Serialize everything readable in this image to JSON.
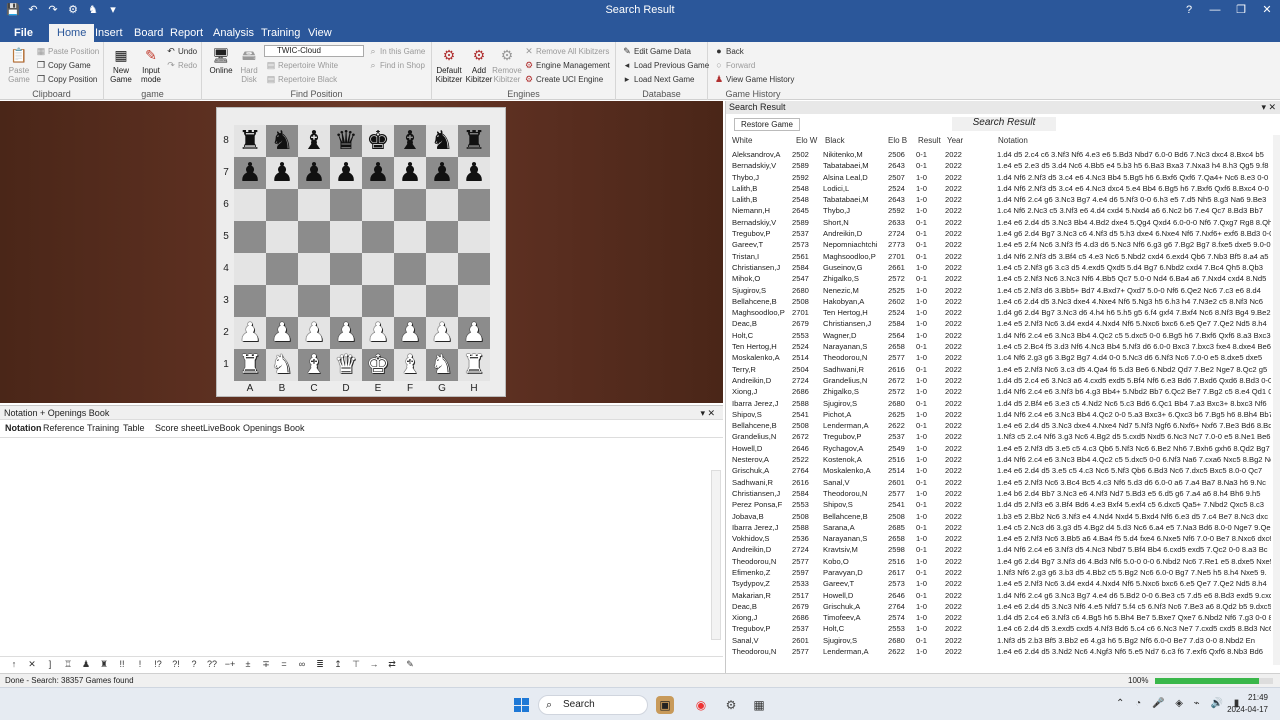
{
  "titlebar": {
    "title": "Search Result",
    "quick_access": [
      "💾",
      "↶",
      "↷",
      "⚙",
      "♞",
      "▾"
    ],
    "window_buttons": [
      "?",
      "—",
      "❐",
      "✕"
    ]
  },
  "ribbon_tabs": {
    "file": "File",
    "home": "Home",
    "insert": "Insert",
    "board": "Board",
    "report": "Report",
    "analysis": "Analysis",
    "training": "Training",
    "view": "View"
  },
  "ribbon": {
    "clipboard": {
      "label": "Clipboard",
      "paste_game": "Paste\nGame",
      "paste_position": "Paste Position",
      "copy_game": "Copy Game",
      "copy_position": "Copy Position"
    },
    "game": {
      "label": "game",
      "new_game": "New\nGame",
      "input_mode": "Input\nmode",
      "undo": "Undo",
      "redo": "Redo"
    },
    "find_position": {
      "label": "Find Position",
      "online": "Online",
      "hard_disk": "Hard\nDisk",
      "dropdown_value": "TWIC-Cloud",
      "in_this_game": "In this Game",
      "find_in_shop": "Find in Shop",
      "repertoire_white": "Repertoire White",
      "repertoire_black": "Repertoire Black"
    },
    "engines": {
      "label": "Engines",
      "default_kibitzer": "Default\nKibitzer",
      "add_kibitzer": "Add\nKibitzer",
      "remove_kibitzer": "Remove\nKibitzer",
      "remove_all_kibitzers": "Remove All Kibitzers",
      "engine_management": "Engine Management",
      "create_uci_engine": "Create UCI Engine"
    },
    "database": {
      "label": "Database",
      "edit_game_data": "Edit Game Data",
      "load_previous_game": "Load Previous Game",
      "load_next_game": "Load Next Game"
    },
    "game_history": {
      "label": "Game History",
      "back": "Back",
      "forward": "Forward",
      "view_game_history": "View Game History"
    }
  },
  "board": {
    "ranks": [
      "8",
      "7",
      "6",
      "5",
      "4",
      "3",
      "2",
      "1"
    ],
    "files": [
      "A",
      "B",
      "C",
      "D",
      "E",
      "F",
      "G",
      "H"
    ],
    "position": [
      [
        "br",
        "bn",
        "bb",
        "bq",
        "bk",
        "bb",
        "bn",
        "br"
      ],
      [
        "bp",
        "bp",
        "bp",
        "bp",
        "bp",
        "bp",
        "bp",
        "bp"
      ],
      [
        "",
        "",
        "",
        "",
        "",
        "",
        "",
        ""
      ],
      [
        "",
        "",
        "",
        "",
        "",
        "",
        "",
        ""
      ],
      [
        "",
        "",
        "",
        "",
        "",
        "",
        "",
        ""
      ],
      [
        "",
        "",
        "",
        "",
        "",
        "",
        "",
        ""
      ],
      [
        "wp",
        "wp",
        "wp",
        "wp",
        "wp",
        "wp",
        "wp",
        "wp"
      ],
      [
        "wr",
        "wn",
        "wb",
        "wq",
        "wk",
        "wb",
        "wn",
        "wr"
      ]
    ]
  },
  "notation_pane": {
    "header": "Notation + Openings Book",
    "tabs": [
      "Notation",
      "Reference",
      "Training",
      "Table",
      "Score sheet",
      "LiveBook",
      "Openings Book"
    ],
    "toolbar_icons": [
      "↑",
      "✕",
      "]",
      "♖",
      "♟",
      "♜",
      "!!",
      "!",
      "!?",
      "?!",
      "?",
      "??",
      "−+",
      "±",
      "∓",
      "=",
      "∞",
      "≣",
      "↥",
      "⊤",
      "→",
      "⇄",
      "✎"
    ]
  },
  "search_result": {
    "pane_title": "Search Result",
    "restore_button": "Restore Game",
    "title": "Search Result",
    "columns": [
      "White",
      "Elo W",
      "Black",
      "Elo B",
      "Result",
      "Year",
      "Notation"
    ],
    "rows": [
      [
        "Aleksandrov,A",
        "2502",
        "Nikitenko,M",
        "2506",
        "0-1",
        "2022",
        "1.d4 d5 2.c4 c6 3.Nf3 Nf6 4.e3 e6 5.Bd3 Nbd7 6.0-0 Bd6 7.Nc3 dxc4 8.Bxc4 b5"
      ],
      [
        "Bernadskiy,V",
        "2589",
        "Tabatabaei,M",
        "2643",
        "0-1",
        "2022",
        "1.e4 e5 2.e3 d5 3.d4 Nc6 4.Bb5 e4 5.b3 h5 6.Ba3 Bxa3 7.Nxa3 h4 8.h3 Qg5 9.f8"
      ],
      [
        "Thybo,J",
        "2592",
        "Alsina Leal,D",
        "2507",
        "1-0",
        "2022",
        "1.d4 Nf6 2.Nf3 d5 3.c4 e6 4.Nc3 Bb4 5.Bg5 h6 6.Bxf6 Qxf6 7.Qa4+ Nc6 8.e3 0-0"
      ],
      [
        "Lalith,B",
        "2548",
        "Lodici,L",
        "2524",
        "1-0",
        "2022",
        "1.d4 Nf6 2.Nf3 d5 3.c4 e6 4.Nc3 dxc4 5.e4 Bb4 6.Bg5 h6 7.Bxf6 Qxf6 8.Bxc4 0-0"
      ],
      [
        "Lalith,B",
        "2548",
        "Tabatabaei,M",
        "2643",
        "1-0",
        "2022",
        "1.d4 Nf6 2.c4 g6 3.Nc3 Bg7 4.e4 d6 5.Nf3 0-0 6.h3 e5 7.d5 Nh5 8.g3 Na6 9.Be3"
      ],
      [
        "Niemann,H",
        "2645",
        "Thybo,J",
        "2592",
        "1-0",
        "2022",
        "1.c4 Nf6 2.Nc3 c5 3.Nf3 e6 4.d4 cxd4 5.Nxd4 a6 6.Nc2 b6 7.e4 Qc7 8.Bd3 Bb7"
      ],
      [
        "Bernadskiy,V",
        "2589",
        "Short,N",
        "2633",
        "0-1",
        "2022",
        "1.e4 e6 2.d4 d5 3.Nc3 Bb4 4.Bd2 dxe4 5.Qg4 Qxd4 6.0-0-0 Nf6 7.Qxg7 Rg8 8.Qh6"
      ],
      [
        "Tregubov,P",
        "2537",
        "Andreikin,D",
        "2724",
        "0-1",
        "2022",
        "1.e4 g6 2.d4 Bg7 3.Nc3 c6 4.Nf3 d5 5.h3 dxe4 6.Nxe4 Nf6 7.Nxf6+ exf6 8.Bd3 0-0"
      ],
      [
        "Gareev,T",
        "2573",
        "Nepomniachtchi",
        "2773",
        "0-1",
        "2022",
        "1.e4 e5 2.f4 Nc6 3.Nf3 f5 4.d3 d6 5.Nc3 Nf6 6.g3 g6 7.Bg2 Bg7 8.fxe5 dxe5 9.0-0"
      ],
      [
        "Tristan,I",
        "2561",
        "Maghsoodloo,P",
        "2701",
        "0-1",
        "2022",
        "1.d4 Nf6 2.Nf3 d5 3.Bf4 c5 4.e3 Nc6 5.Nbd2 cxd4 6.exd4 Qb6 7.Nb3 Bf5 8.a4 a5"
      ],
      [
        "Christiansen,J",
        "2584",
        "Guseinov,G",
        "2661",
        "1-0",
        "2022",
        "1.e4 c5 2.Nf3 g6 3.c3 d5 4.exd5 Qxd5 5.d4 Bg7 6.Nbd2 cxd4 7.Bc4 Qh5 8.Qb3"
      ],
      [
        "Mihok,O",
        "2547",
        "Zhigalko,S",
        "2572",
        "0-1",
        "2022",
        "1.e4 c5 2.Nf3 Nc6 3.Nc3 Nf6 4.Bb5 Qc7 5.0-0 Nd4 6.Ba4 a6 7.Nxd4 cxd4 8.Nd5"
      ],
      [
        "Sjugirov,S",
        "2680",
        "Nenezic,M",
        "2525",
        "1-0",
        "2022",
        "1.e4 c5 2.Nf3 d6 3.Bb5+ Bd7 4.Bxd7+ Qxd7 5.0-0 Nf6 6.Qe2 Nc6 7.c3 e6 8.d4"
      ],
      [
        "Bellahcene,B",
        "2508",
        "Hakobyan,A",
        "2602",
        "1-0",
        "2022",
        "1.e4 c6 2.d4 d5 3.Nc3 dxe4 4.Nxe4 Nf6 5.Ng3 h5 6.h3 h4 7.N3e2 c5 8.Nf3 Nc6"
      ],
      [
        "Maghsoodloo,P",
        "2701",
        "Ten Hertog,H",
        "2524",
        "1-0",
        "2022",
        "1.d4 g6 2.d4 Bg7 3.Nc3 d6 4.h4 h6 5.h5 g5 6.f4 gxf4 7.Bxf4 Nc6 8.Nf3 Bg4 9.Be2"
      ],
      [
        "Deac,B",
        "2679",
        "Christiansen,J",
        "2584",
        "1-0",
        "2022",
        "1.e4 e5 2.Nf3 Nc6 3.d4 exd4 4.Nxd4 Nf6 5.Nxc6 bxc6 6.e5 Qe7 7.Qe2 Nd5 8.h4"
      ],
      [
        "Holt,C",
        "2553",
        "Wagner,D",
        "2564",
        "1-0",
        "2022",
        "1.d4 Nf6 2.c4 e6 3.Nc3 Bb4 4.Qc2 c5 5.dxc5 0-0 6.Bg5 h6 7.Bxf6 Qxf6 8.a3 Bxc3+"
      ],
      [
        "Ten Hertog,H",
        "2524",
        "Narayanan,S",
        "2658",
        "0-1",
        "2022",
        "1.e4 c5 2.Bc4 f5 3.d3 Nf6 4.Nc3 Bb4 5.Nf3 d6 6.0-0 Bxc3 7.bxc3 fxe4 8.dxe4 Be6"
      ],
      [
        "Moskalenko,A",
        "2514",
        "Theodorou,N",
        "2577",
        "1-0",
        "2022",
        "1.c4 Nf6 2.g3 g6 3.Bg2 Bg7 4.d4 0-0 5.Nc3 d6 6.Nf3 Nc6 7.0-0 e5 8.dxe5 dxe5"
      ],
      [
        "Terry,R",
        "2504",
        "Sadhwani,R",
        "2616",
        "0-1",
        "2022",
        "1.e4 e5 2.Nf3 Nc6 3.c3 d5 4.Qa4 f6 5.d3 Be6 6.Nbd2 Qd7 7.Be2 Nge7 8.Qc2 g5"
      ],
      [
        "Andreikin,D",
        "2724",
        "Grandelius,N",
        "2672",
        "1-0",
        "2022",
        "1.d4 d5 2.c4 e6 3.Nc3 a6 4.cxd5 exd5 5.Bf4 Nf6 6.e3 Bd6 7.Bxd6 Qxd6 8.Bd3 0-0"
      ],
      [
        "Xiong,J",
        "2686",
        "Zhigalko,S",
        "2572",
        "1-0",
        "2022",
        "1.d4 Nf6 2.c4 e6 3.Nf3 b6 4.g3 Bb4+ 5.Nbd2 Bb7 6.Qc2 Be7 7.Bg2 c5 8.e4 Qd1 0-0"
      ],
      [
        "Ibarra Jerez,J",
        "2588",
        "Sjugirov,S",
        "2680",
        "0-1",
        "2022",
        "1.d4 d5 2.Bf4 e6 3.e3 c5 4.Nd2 Nc6 5.c3 Bd6 6.Qc1 Bb4 7.a3 Bxc3+ 8.bxc3 Nf6"
      ],
      [
        "Shipov,S",
        "2541",
        "Pichot,A",
        "2625",
        "1-0",
        "2022",
        "1.d4 Nf6 2.c4 e6 3.Nc3 Bb4 4.Qc2 0-0 5.a3 Bxc3+ 6.Qxc3 b6 7.Bg5 h6 8.Bh4 Bb7"
      ],
      [
        "Bellahcene,B",
        "2508",
        "Lenderman,A",
        "2622",
        "0-1",
        "2022",
        "1.e4 e6 2.d4 d5 3.Nc3 dxe4 4.Nxe4 Nd7 5.Nf3 Ngf6 6.Nxf6+ Nxf6 7.Be3 Bd6 8.Bd3"
      ],
      [
        "Grandelius,N",
        "2672",
        "Tregubov,P",
        "2537",
        "1-0",
        "2022",
        "1.Nf3 c5 2.c4 Nf6 3.g3 Nc6 4.Bg2 d5 5.cxd5 Nxd5 6.Nc3 Nc7 7.0-0 e5 8.Ne1 Be6"
      ],
      [
        "Howell,D",
        "2646",
        "Rychagov,A",
        "2549",
        "1-0",
        "2022",
        "1.e4 e5 2.Nf3 d5 3.e5 c5 4.c3 Qb6 5.Nf3 Nc6 6.Be2 Nh6 7.Bxh6 gxh6 8.Qd2 Bg7"
      ],
      [
        "Nesterov,A",
        "2522",
        "Kostenok,A",
        "2516",
        "1-0",
        "2022",
        "1.d4 Nf6 2.c4 e6 3.Nc3 Bb4 4.Qc2 c5 5.dxc5 0-0 6.Nf3 Na6 7.cxa6 Nxc5 8.Bg2 Nc"
      ],
      [
        "Grischuk,A",
        "2764",
        "Moskalenko,A",
        "2514",
        "1-0",
        "2022",
        "1.e4 e6 2.d4 d5 3.e5 c5 4.c3 Nc6 5.Nf3 Qb6 6.Bd3 Nc6 7.dxc5 Bxc5 8.0-0 Qc7"
      ],
      [
        "Sadhwani,R",
        "2616",
        "Sanal,V",
        "2601",
        "0-1",
        "2022",
        "1.e4 e5 2.Nf3 Nc6 3.Bc4 Bc5 4.c3 Nf6 5.d3 d6 6.0-0 a6 7.a4 Ba7 8.Na3 h6 9.Nc"
      ],
      [
        "Christiansen,J",
        "2584",
        "Theodorou,N",
        "2577",
        "1-0",
        "2022",
        "1.e4 b6 2.d4 Bb7 3.Nc3 e6 4.Nf3 Nd7 5.Bd3 e5 6.d5 g6 7.a4 a6 8.h4 Bh6 9.h5"
      ],
      [
        "Perez Ponsa,F",
        "2553",
        "Shipov,S",
        "2541",
        "0-1",
        "2022",
        "1.d4 d5 2.Nf3 e6 3.Bf4 Bd6 4.e3 Bxf4 5.exf4 c5 6.dxc5 Qa5+ 7.Nbd2 Qxc5 8.c3"
      ],
      [
        "Jobava,B",
        "2508",
        "Bellahcene,B",
        "2508",
        "1-0",
        "2022",
        "1.b3 e5 2.Bb2 Nc6 3.Nf3 e4 4.Nd4 Nxd4 5.Bxd4 Nf6 6.e3 d5 7.c4 Be7 8.Nc3 dxc"
      ],
      [
        "Ibarra Jerez,J",
        "2588",
        "Sarana,A",
        "2685",
        "0-1",
        "2022",
        "1.e4 c5 2.Nc3 d6 3.g3 d5 4.Bg2 d4 5.d3 Nc6 6.a4 e5 7.Na3 Bd6 8.0-0 Nge7 9.Qe"
      ],
      [
        "Vokhidov,S",
        "2536",
        "Narayanan,S",
        "2658",
        "1-0",
        "2022",
        "1.e4 e5 2.Nf3 Nc6 3.Bb5 a6 4.Ba4 f5 5.d4 fxe4 6.Nxe5 Nf6 7.0-0 Be7 8.Nxc6 dxc6"
      ],
      [
        "Andreikin,D",
        "2724",
        "Kravtsiv,M",
        "2598",
        "0-1",
        "2022",
        "1.d4 Nf6 2.c4 e6 3.Nf3 d5 4.Nc3 Nbd7 5.Bf4 Bb4 6.cxd5 exd5 7.Qc2 0-0 8.a3 Bc"
      ],
      [
        "Theodorou,N",
        "2577",
        "Kobo,O",
        "2516",
        "1-0",
        "2022",
        "1.e4 g6 2.d4 Bg7 3.Nf3 d6 4.Bd3 Nf6 5.0-0 0-0 6.Nbd2 Nc6 7.Re1 e5 8.dxe5 Nxe5"
      ],
      [
        "Efimenko,Z",
        "2597",
        "Paravyan,D",
        "2617",
        "0-1",
        "2022",
        "1.Nf3 Nf6 2.g3 g6 3.b3 d5 4.Bb2 c5 5.Bg2 Nc6 6.0-0 Bg7 7.Ne5 h5 8.h4 Nxe5 9."
      ],
      [
        "Tsydypov,Z",
        "2533",
        "Gareev,T",
        "2573",
        "1-0",
        "2022",
        "1.e4 e5 2.Nf3 Nc6 3.d4 exd4 4.Nxd4 Nf6 5.Nxc6 bxc6 6.e5 Qe7 7.Qe2 Nd5 8.h4"
      ],
      [
        "Makarian,R",
        "2517",
        "Howell,D",
        "2646",
        "0-1",
        "2022",
        "1.d4 Nf6 2.c4 g6 3.Nc3 Bg7 4.e4 d6 5.Bd2 0-0 6.Be3 c5 7.d5 e6 8.Bd3 exd5 9.cxd5"
      ],
      [
        "Deac,B",
        "2679",
        "Grischuk,A",
        "2764",
        "1-0",
        "2022",
        "1.e4 e6 2.d4 d5 3.Nc3 Nf6 4.e5 Nfd7 5.f4 c5 6.Nf3 Nc6 7.Be3 a6 8.Qd2 b5 9.dxc5"
      ],
      [
        "Xiong,J",
        "2686",
        "Timofeev,A",
        "2574",
        "1-0",
        "2022",
        "1.d4 d5 2.c4 e6 3.Nf3 c6 4.Bg5 h6 5.Bh4 Be7 5.Bxe7 Qxe7 6.Nbd2 Nf6 7.g3 0-0 8.Bg2 b6"
      ],
      [
        "Tregubov,P",
        "2537",
        "Holt,C",
        "2553",
        "1-0",
        "2022",
        "1.e4 c6 2.d4 d5 3.exd5 cxd5 4.Nf3 Bd6 5.c4 c6 6.Nc3 Ne7 7.cxd5 cxd5 8.Bd3 Nc6"
      ],
      [
        "Sanal,V",
        "2601",
        "Sjugirov,S",
        "2680",
        "0-1",
        "2022",
        "1.Nf3 d5 2.b3 Bf5 3.Bb2 e6 4.g3 h6 5.Bg2 Nf6 6.0-0 Be7 7.d3 0-0 8.Nbd2 En"
      ],
      [
        "Theodorou,N",
        "2577",
        "Lenderman,A",
        "2622",
        "1-0",
        "2022",
        "1.e4 e6 2.d4 d5 3.Nd2 Nc6 4.Ngf3 Nf6 5.e5 Nd7 6.c3 f6 7.exf6 Qxf6 8.Nb3 Bd6"
      ]
    ]
  },
  "statusbar": {
    "text": "Done - Search: 38357 Games found",
    "zoom": "100%",
    "progress": 0.88
  },
  "taskbar": {
    "search_label": "Search",
    "time": "21:49",
    "date": "2024-04-17"
  }
}
